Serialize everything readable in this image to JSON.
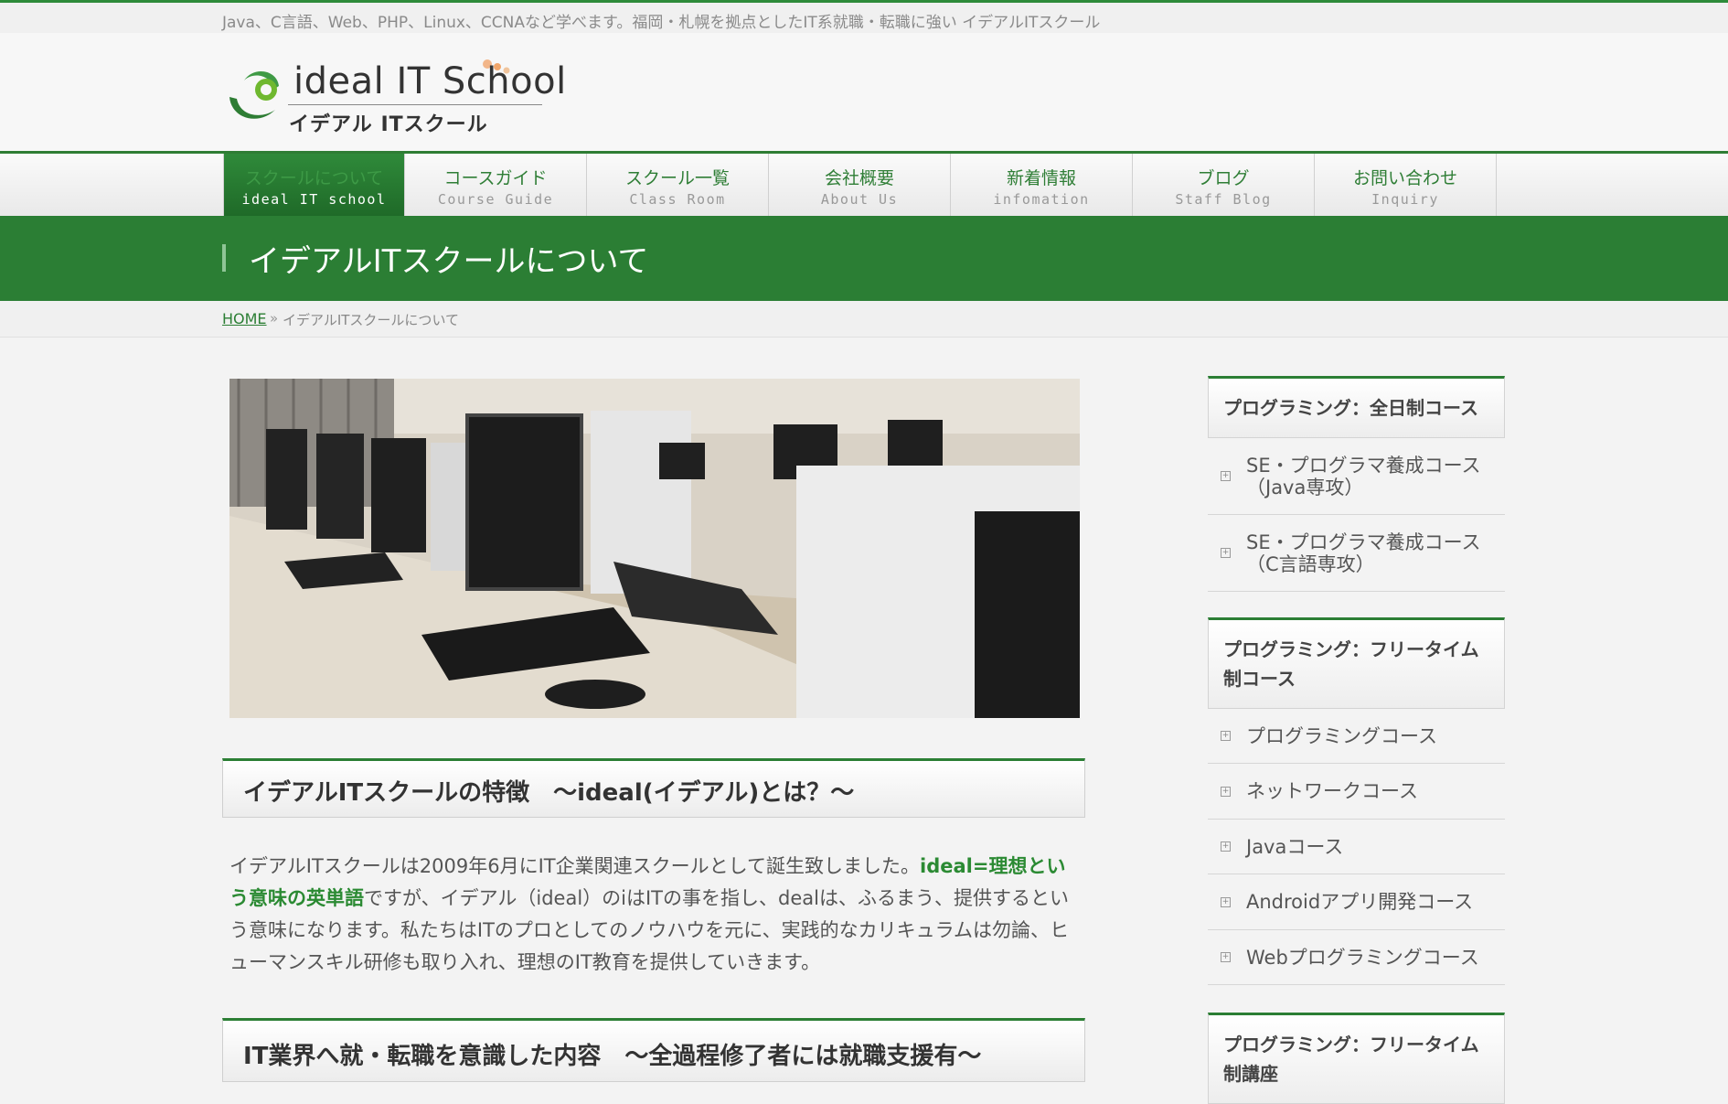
{
  "tagline": "Java、C言語、Web、PHP、Linux、CCNAなど学べます。福岡・札幌を拠点としたIT系就職・転職に強い イデアルITスクール",
  "logo": {
    "en": "ideal IT School",
    "ja": "イデアル ITスクール"
  },
  "nav": [
    {
      "ja": "スクールについて",
      "en": "ideal IT school",
      "active": true
    },
    {
      "ja": "コースガイド",
      "en": "Course Guide"
    },
    {
      "ja": "スクール一覧",
      "en": "Class Room"
    },
    {
      "ja": "会社概要",
      "en": "About Us"
    },
    {
      "ja": "新着情報",
      "en": "infomation"
    },
    {
      "ja": "ブログ",
      "en": "Staff Blog"
    },
    {
      "ja": "お問い合わせ",
      "en": "Inquiry"
    }
  ],
  "page_title": "イデアルITスクールについて",
  "breadcrumb": {
    "home": "HOME",
    "sep": "»",
    "current": "イデアルITスクールについて"
  },
  "sections": [
    {
      "heading": "イデアルITスクールの特徴　～ideal(イデアル)とは？～"
    },
    {
      "heading": "IT業界へ就・転職を意識した内容　～全過程修了者には就職支援有～"
    }
  ],
  "intro": {
    "part1": "イデアルITスクールは2009年6月にIT企業関連スクールとして誕生致しました。",
    "highlight": "ideal=理想という意味の英単語",
    "part2": "ですが、イデアル（ideal）のiはITの事を指し、dealは、ふるまう、提供するという意味になります。私たちはITのプロとしてのノウハウを元に、実践的なカリキュラムは勿論、ヒューマンスキル研修も取り入れ、理想のIT教育を提供していきます。"
  },
  "sidebar": [
    {
      "title": "プログラミング：全日制コース",
      "items": [
        "SE・プログラマ養成コース（Java専攻）",
        "SE・プログラマ養成コース（C言語専攻）"
      ]
    },
    {
      "title": "プログラミング：フリータイム制コース",
      "items": [
        "プログラミングコース",
        "ネットワークコース",
        "Javaコース",
        "Androidアプリ開発コース",
        "Webプログラミングコース"
      ]
    },
    {
      "title": "プログラミング：フリータイム制講座",
      "items": []
    }
  ],
  "colors": {
    "brand_green": "#2b7e34",
    "highlight_green": "#2b8a33"
  }
}
